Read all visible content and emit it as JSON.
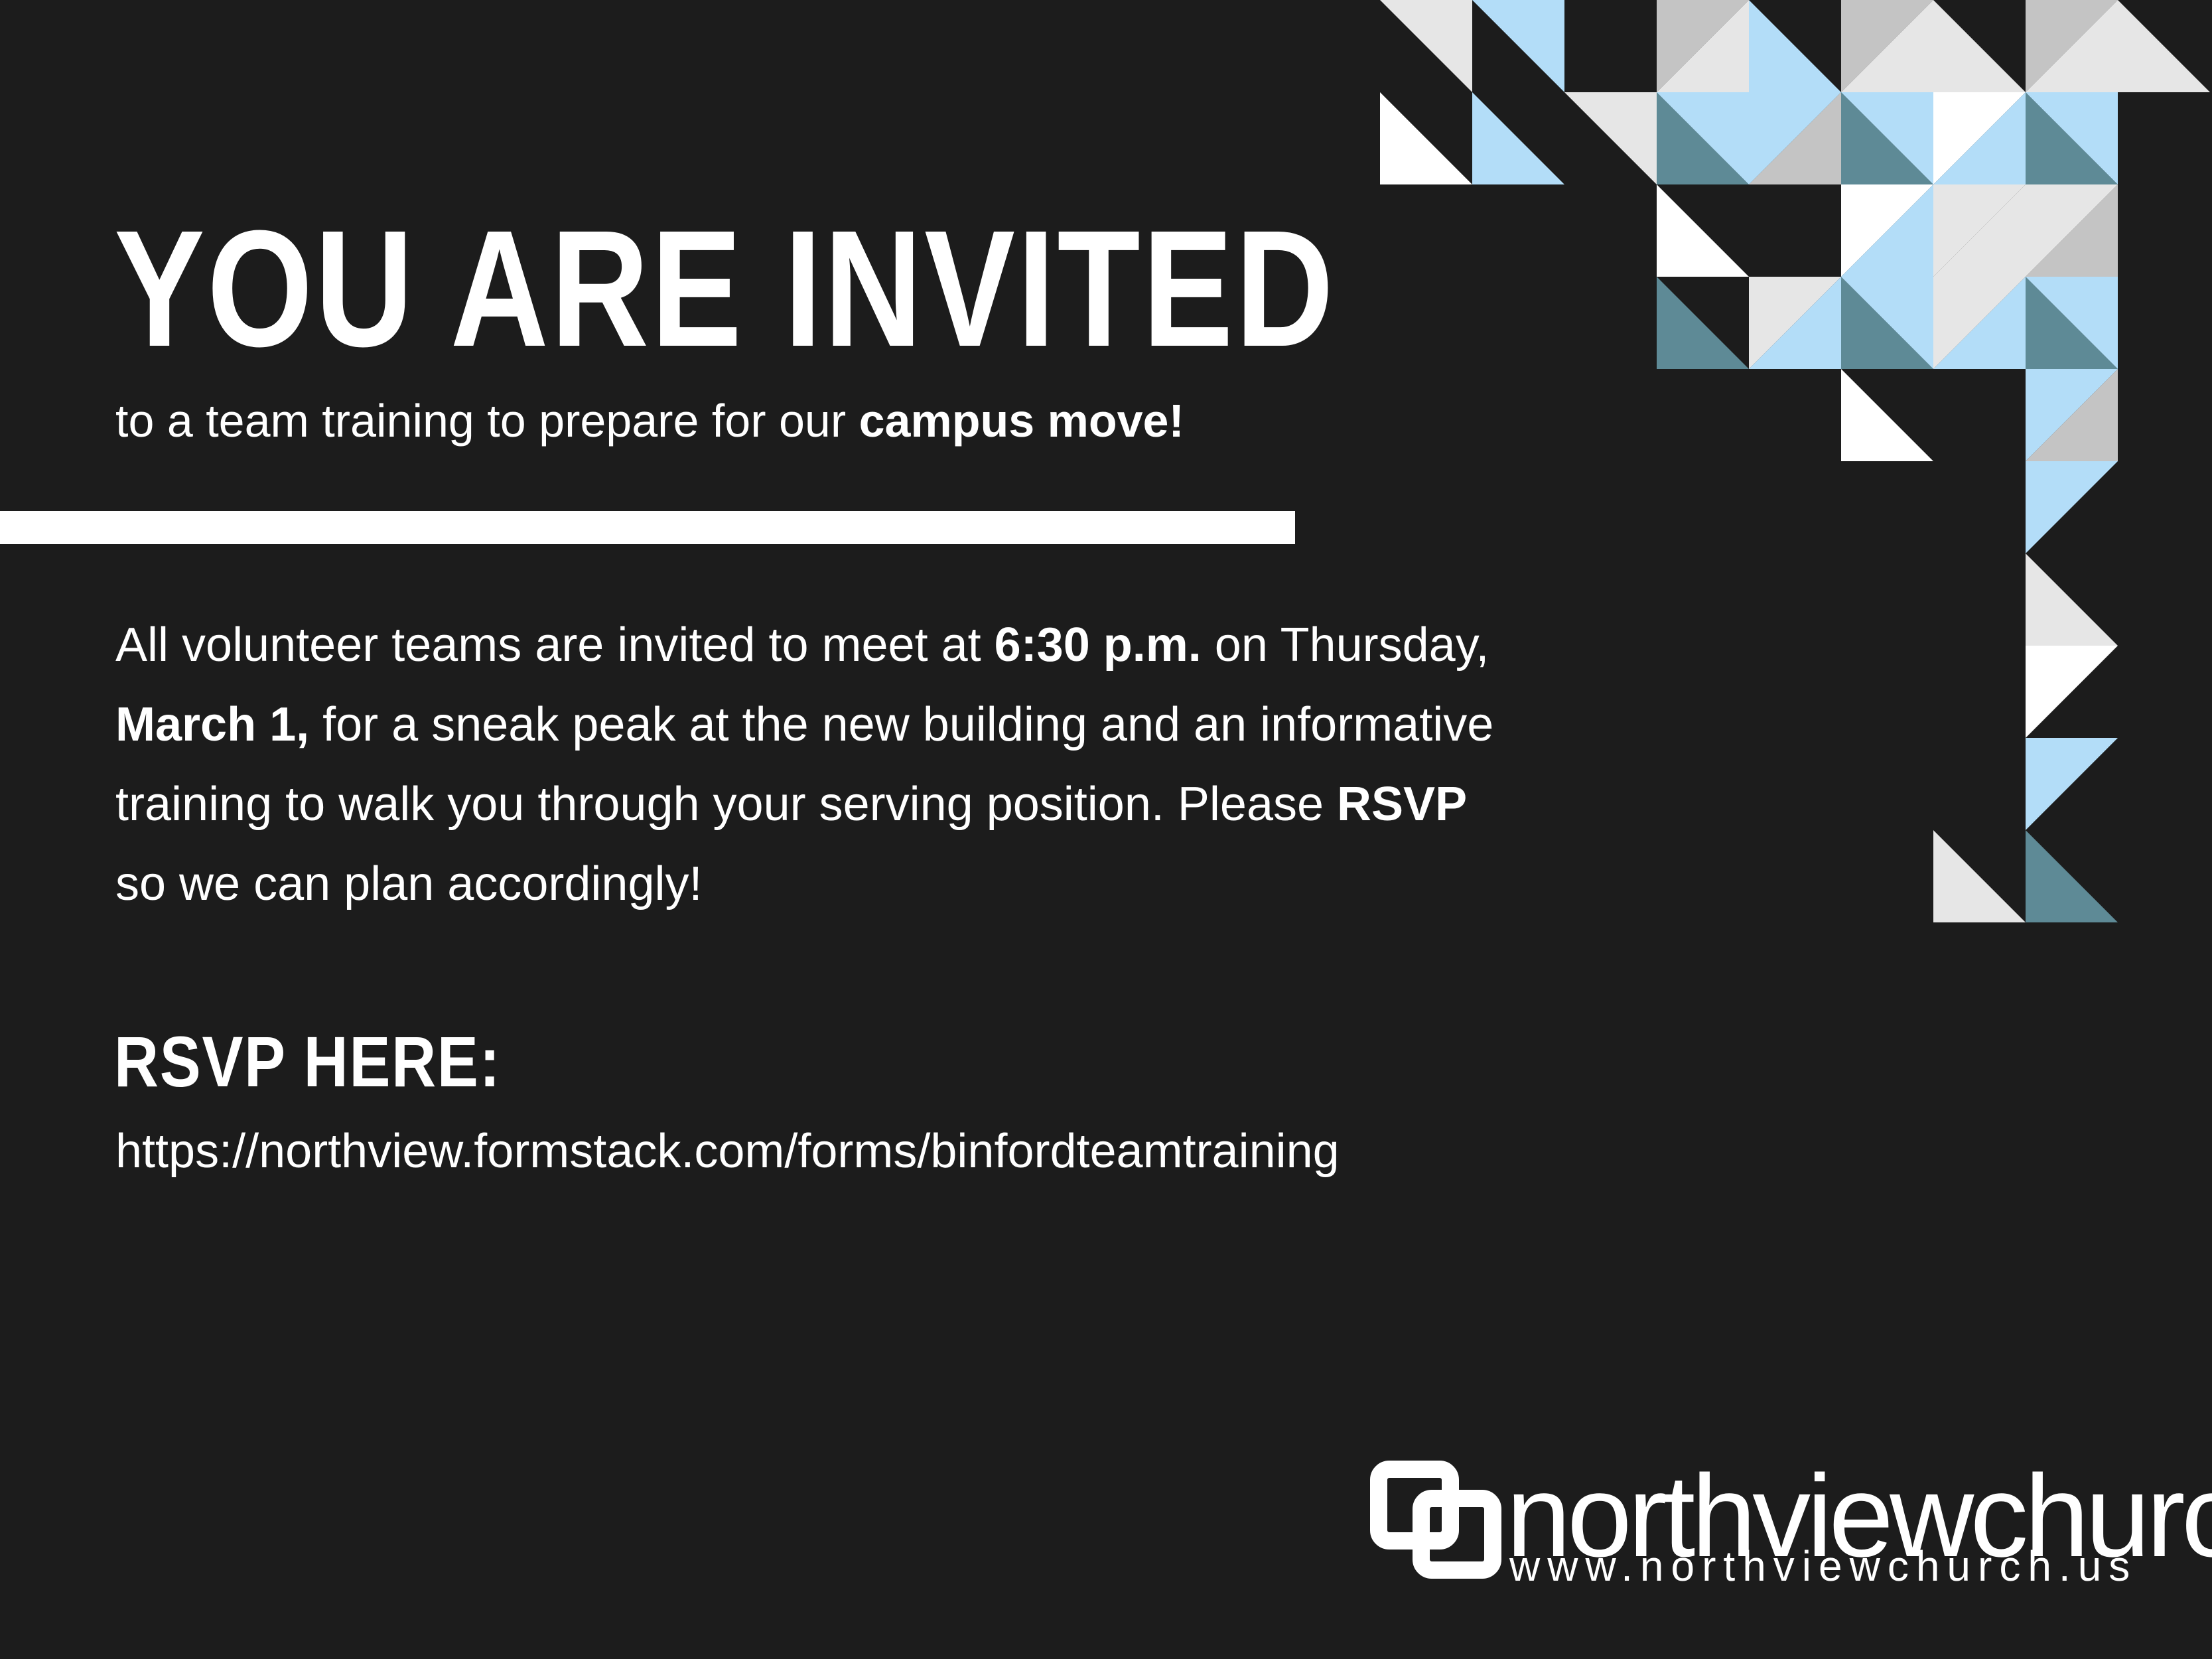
{
  "invitation": {
    "headline": "YOU ARE INVITED",
    "subline_prefix": "to a team training to prepare for our ",
    "subline_bold": "campus move!",
    "body": {
      "p1": "All volunteer teams are invited to meet at ",
      "b1": "6:30 p.m.",
      "p2": " on Thursday, ",
      "b2": "March 1,",
      "p3": " for a sneak peak at the new building and an informative training to walk you through your serving position. Please ",
      "b3": "RSVP",
      "p4": " so we can plan accordingly!"
    },
    "rsvp_heading": "RSVP HERE:",
    "rsvp_url": "https://northview.formstack.com/forms/binfordteamtraining"
  },
  "logo": {
    "name": "northviewchurch",
    "url": "www.northviewchurch.us",
    "icon": "overlapping-squares-logo-icon"
  },
  "colors": {
    "background": "#1c1c1c",
    "text": "#ffffff",
    "light_blue": "#b3ddf8",
    "teal": "#5e8a96",
    "light_gray": "#e6e6e6",
    "mid_gray": "#c4c4c4",
    "white": "#ffffff"
  }
}
